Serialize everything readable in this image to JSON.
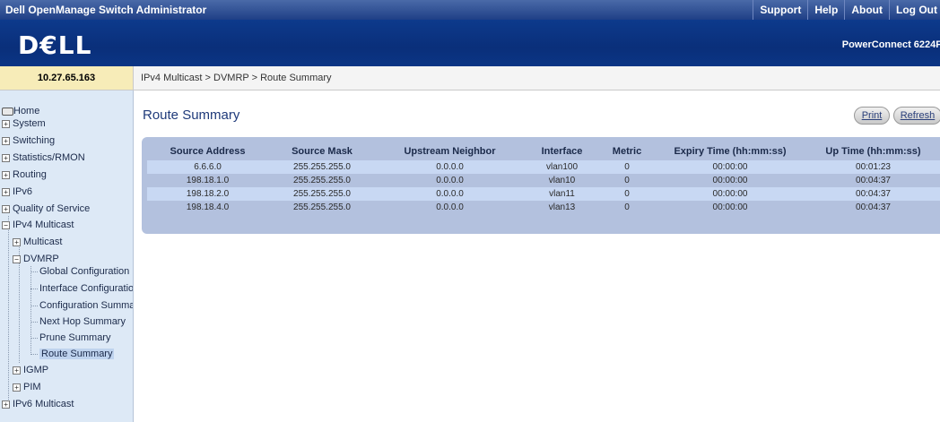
{
  "app_title": "Dell OpenManage Switch Administrator",
  "top_links": [
    "Support",
    "Help",
    "About",
    "Log Out"
  ],
  "brand": {
    "logo": "D€LL",
    "model": "PowerConnect 6224F"
  },
  "ip_address": "10.27.65.163",
  "breadcrumb": "IPv4 Multicast > DVMRP > Route Summary",
  "nav": {
    "home": "Home",
    "system": "System",
    "switching": "Switching",
    "statistics": "Statistics/RMON",
    "routing": "Routing",
    "ipv6": "IPv6",
    "qos": "Quality of Service",
    "ipv4_multicast": "IPv4 Multicast",
    "multicast": "Multicast",
    "dvmrp": "DVMRP",
    "global_config": "Global Configuration",
    "interface_config": "Interface Configuration",
    "config_summary": "Configuration Summary",
    "next_hop": "Next Hop Summary",
    "prune": "Prune Summary",
    "route_summary": "Route Summary",
    "igmp": "IGMP",
    "pim": "PIM",
    "ipv6_multicast": "IPv6 Multicast"
  },
  "page": {
    "title": "Route Summary",
    "print_label": "Print",
    "refresh_label": "Refresh"
  },
  "table": {
    "headers": [
      "Source Address",
      "Source Mask",
      "Upstream Neighbor",
      "Interface",
      "Metric",
      "Expiry Time (hh:mm:ss)",
      "Up Time (hh:mm:ss)"
    ],
    "rows": [
      [
        "6.6.6.0",
        "255.255.255.0",
        "0.0.0.0",
        "vlan100",
        "0",
        "00:00:00",
        "00:01:23"
      ],
      [
        "198.18.1.0",
        "255.255.255.0",
        "0.0.0.0",
        "vlan10",
        "0",
        "00:00:00",
        "00:04:37"
      ],
      [
        "198.18.2.0",
        "255.255.255.0",
        "0.0.0.0",
        "vlan11",
        "0",
        "00:00:00",
        "00:04:37"
      ],
      [
        "198.18.4.0",
        "255.255.255.0",
        "0.0.0.0",
        "vlan13",
        "0",
        "00:00:00",
        "00:04:37"
      ]
    ]
  },
  "colors": {
    "header_bar": "#1f3f86",
    "logo_band": "#0a2f7a",
    "nav_bg": "#dde9f6",
    "table_bg": "#b3c1de",
    "row_highlight": "#c8d8f3"
  }
}
